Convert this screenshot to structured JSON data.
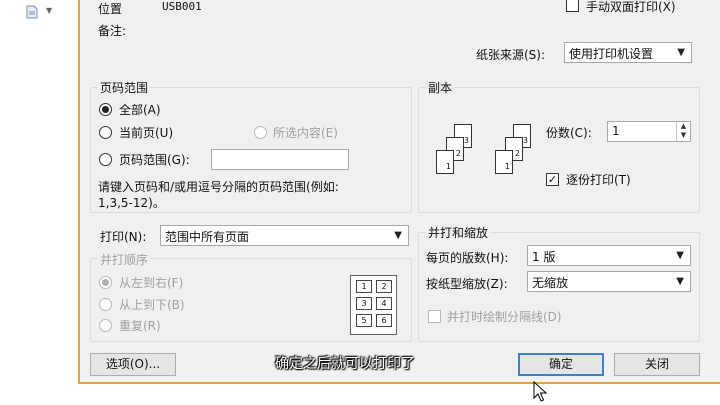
{
  "top": {
    "location_label": "位置",
    "location_value": "USB001",
    "notes_label": "备注:",
    "duplex_label": "手动双面打印(X)"
  },
  "paper_source": {
    "label": "纸张来源(S):",
    "value": "使用打印机设置"
  },
  "page_range": {
    "title": "页码范围",
    "all": "全部(A)",
    "current": "当前页(U)",
    "selection": "所选内容(E)",
    "pages": "页码范围(G):",
    "pages_value": "",
    "hint_line1": "请键入页码和/或用逗号分隔的页码范围(例如:",
    "hint_line2": "1,3,5-12)。"
  },
  "copies": {
    "title": "副本",
    "count_label": "份数(C):",
    "count_value": "1",
    "collate_label": "逐份打印(T)"
  },
  "print_what": {
    "label": "打印(N):",
    "value": "范围中所有页面"
  },
  "order": {
    "title": "并打顺序",
    "ltr": "从左到右(F)",
    "ttb": "从上到下(B)",
    "repeat": "重复(R)",
    "cells": [
      "1",
      "2",
      "3",
      "4",
      "5",
      "6"
    ]
  },
  "zoom": {
    "title": "并打和缩放",
    "per_sheet_label": "每页的版数(H):",
    "per_sheet_value": "1 版",
    "scale_label": "按纸型缩放(Z):",
    "scale_value": "无缩放",
    "lines_label": "并打时绘制分隔线(D)"
  },
  "buttons": {
    "options": "选项(O)...",
    "ok": "确定",
    "close": "关闭"
  },
  "caption": "确定之后就可以打印了",
  "stack_a": [
    "1",
    "2",
    "3"
  ],
  "stack_b": [
    "1",
    "2",
    "3"
  ]
}
